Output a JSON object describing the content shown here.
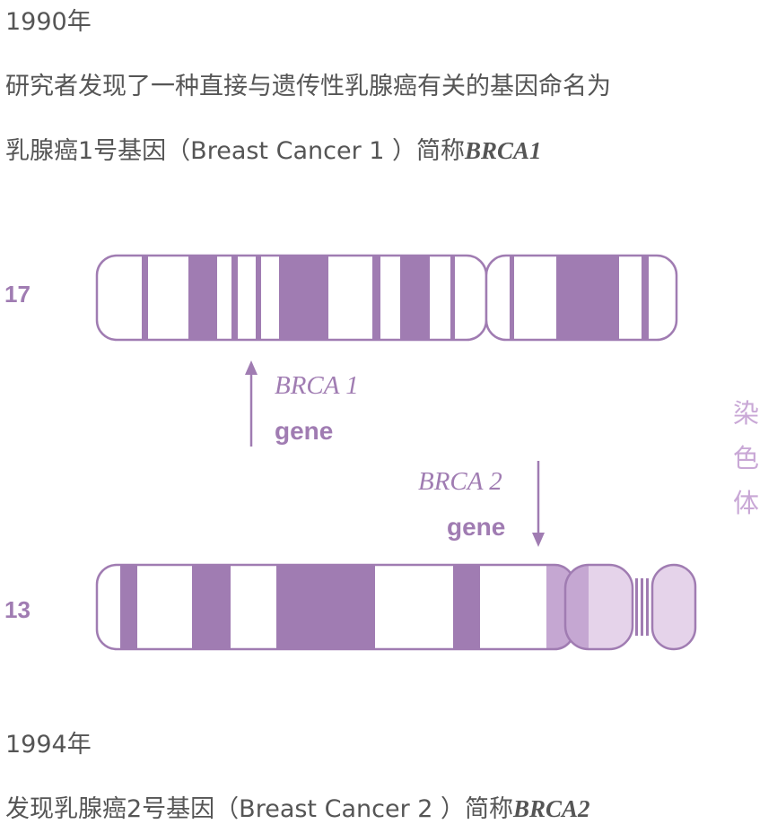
{
  "texts": {
    "year_1990": "1990年",
    "line1": "研究者发现了一种直接与遗传性乳腺癌有关的基因命名为",
    "line2_prefix": "乳腺癌1号基因（Breast Cancer 1 ）简称",
    "line2_gene": "BRCA1",
    "year_1994": "1994年",
    "line3_prefix": "发现乳腺癌2号基因（Breast Cancer 2 ）简称",
    "line3_gene": "BRCA2"
  },
  "diagram": {
    "chromosome_17_label": "17",
    "chromosome_13_label": "13",
    "gene1_name": "BRCA 1",
    "gene1_word": "gene",
    "gene2_name": "BRCA 2",
    "gene2_word": "gene",
    "side_label": [
      "染",
      "色",
      "体"
    ]
  },
  "colors": {
    "band": "#a07cb2",
    "band_light": "#c5a7d2",
    "band_lighter": "#e5d3ea",
    "outline": "#a07cb2",
    "text": "#555555",
    "side_label": "#c9a8d6"
  }
}
